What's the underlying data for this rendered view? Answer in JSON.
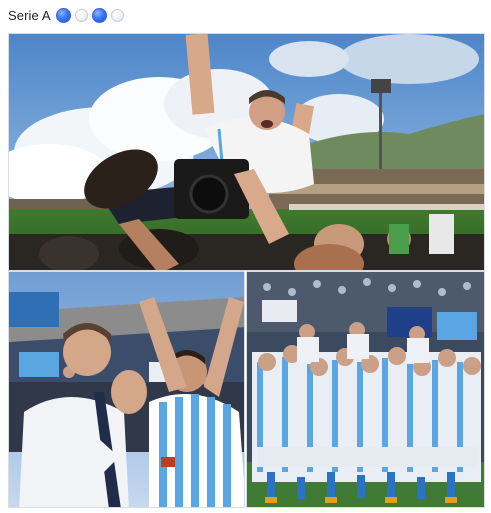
{
  "post": {
    "text": "Serie A",
    "emoji_sequence": [
      "blue-circle",
      "white-circle",
      "blue-circle",
      "white-circle"
    ],
    "colors": {
      "blue_circle": "#3b78f5",
      "white_circle": "#eef1f6",
      "team_light_blue": "#5aa6e3"
    }
  },
  "photos": [
    {
      "name": "celebration-coach-lifted-photo"
    },
    {
      "name": "president-and-player-celebrating-photo"
    },
    {
      "name": "team-group-celebration-photo"
    }
  ]
}
